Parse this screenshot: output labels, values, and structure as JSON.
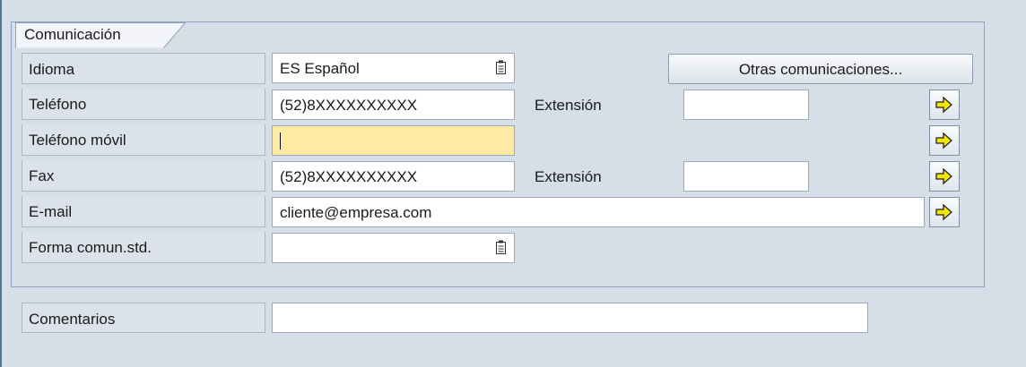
{
  "group": {
    "title": "Comunicación"
  },
  "rows": {
    "idioma": {
      "label": "Idioma",
      "value": "ES Español"
    },
    "telefono": {
      "label": "Teléfono",
      "value": "(52)8XXXXXXXXXX",
      "ext_label": "Extensión",
      "ext_value": ""
    },
    "movil": {
      "label": "Teléfono móvil",
      "value": ""
    },
    "fax": {
      "label": "Fax",
      "value": "(52)8XXXXXXXXXX",
      "ext_label": "Extensión",
      "ext_value": ""
    },
    "email": {
      "label": "E-mail",
      "value": "cliente@empresa.com"
    },
    "forma": {
      "label": "Forma comun.std.",
      "value": ""
    }
  },
  "buttons": {
    "otras": "Otras comunicaciones..."
  },
  "comentarios": {
    "label": "Comentarios",
    "value": ""
  },
  "icons": {
    "arrow": "yellow-right-arrow-icon",
    "dropdown": "dropdown-list-icon"
  },
  "colors": {
    "background": "#d6dee8",
    "required_field": "#fdeaa3",
    "arrow": "#f5e400"
  }
}
